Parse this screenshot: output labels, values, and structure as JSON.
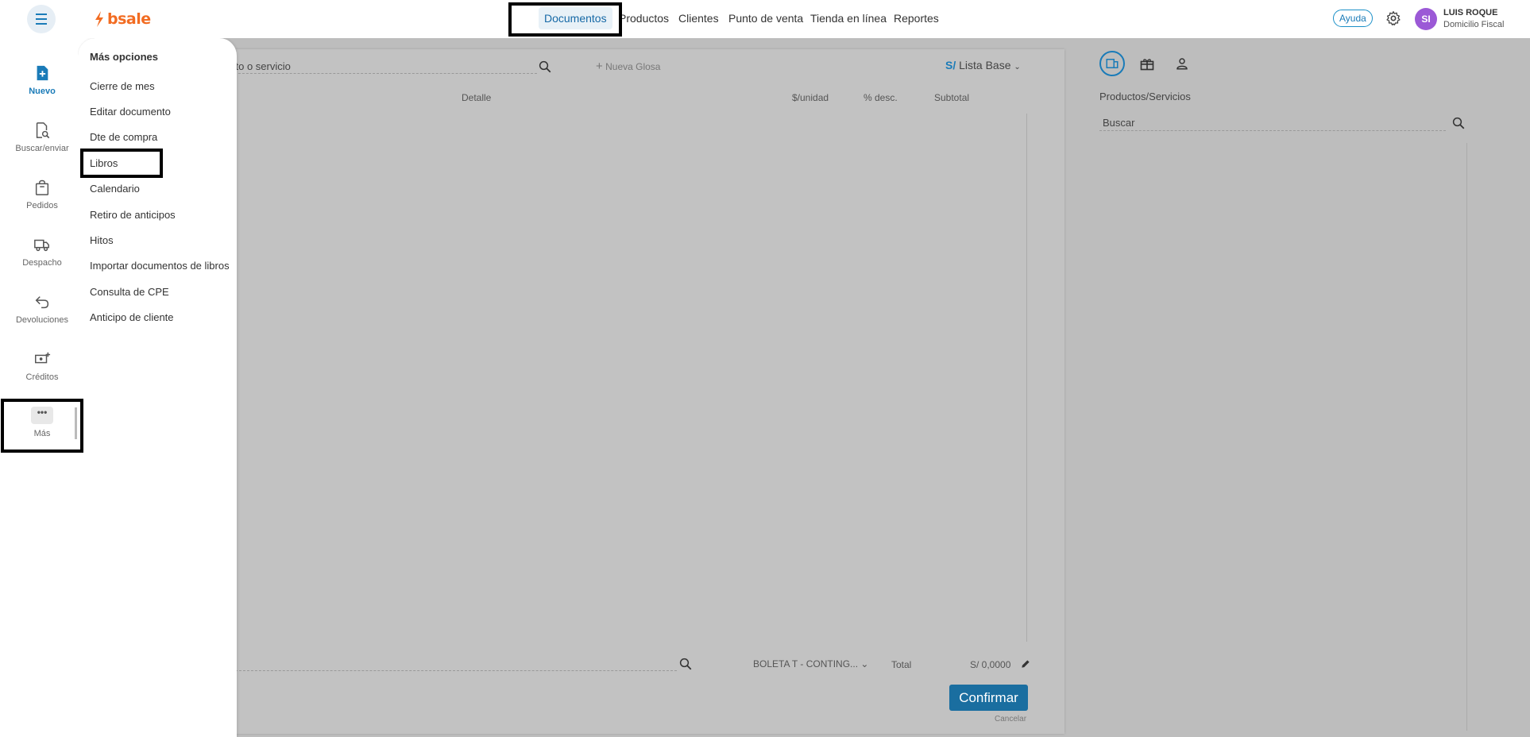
{
  "header": {
    "logo_text": "bsale",
    "nav": [
      "Documentos",
      "Productos",
      "Clientes",
      "Punto de venta",
      "Tienda en línea",
      "Reportes"
    ],
    "help_label": "Ayuda",
    "avatar_initials": "SI",
    "user_name": "LUIS ROQUE",
    "user_subtitle": "Domicilio Fiscal"
  },
  "sidebar": {
    "items": [
      {
        "label": "Nuevo",
        "icon": "new-document-icon"
      },
      {
        "label": "Buscar/enviar",
        "icon": "search-document-icon"
      },
      {
        "label": "Pedidos",
        "icon": "bag-icon"
      },
      {
        "label": "Despacho",
        "icon": "truck-icon"
      },
      {
        "label": "Devoluciones",
        "icon": "return-arrow-icon"
      },
      {
        "label": "Créditos",
        "icon": "cash-plus-icon"
      },
      {
        "label": "Más",
        "icon": "more-dots-icon"
      }
    ]
  },
  "more_menu": {
    "title": "Más opciones",
    "items": [
      "Cierre de mes",
      "Editar documento",
      "Dte de compra",
      "Libros",
      "Calendario",
      "Retiro de anticipos",
      "Hitos",
      "Importar documentos de libros",
      "Consulta de CPE",
      "Anticipo de cliente"
    ]
  },
  "document": {
    "search_partial": "cto o servicio",
    "nueva_glosa": "Nueva Glosa",
    "currency_symbol": "S/",
    "price_list": "Lista Base",
    "columns": [
      "Detalle",
      "$/unidad",
      "% desc.",
      "Subtotal"
    ],
    "doc_type": "BOLETA T - CONTING...",
    "total_label": "Total",
    "total_value": "S/ 0,0000",
    "confirm_label": "Confirmar",
    "cancel_label": "Cancelar"
  },
  "products": {
    "title": "Productos/Servicios",
    "search_placeholder": "Buscar"
  },
  "colors": {
    "brand_orange": "#f26c22",
    "accent_blue": "#1a7bb8",
    "confirm_blue": "#1a6ea0",
    "overlay_grey": "#bdbdbd",
    "avatar_purple": "#9b59d6"
  }
}
